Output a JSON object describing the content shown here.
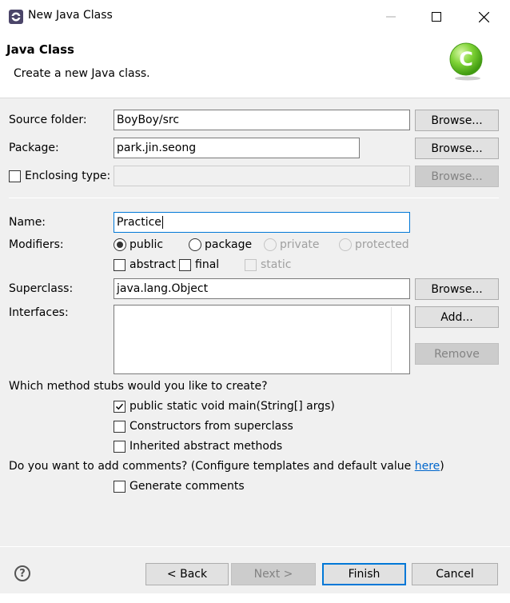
{
  "window": {
    "title": "New Java Class"
  },
  "header": {
    "title": "Java Class",
    "subtitle": "Create a new Java class."
  },
  "source_folder": {
    "label": "Source folder:",
    "value": "BoyBoy/src",
    "browse": "Browse..."
  },
  "package": {
    "label": "Package:",
    "value": "park.jin.seong",
    "browse": "Browse..."
  },
  "enclosing": {
    "label": "Enclosing type:",
    "value": "",
    "checked": false,
    "browse": "Browse..."
  },
  "name": {
    "label": "Name:",
    "value": "Practice"
  },
  "modifiers": {
    "label": "Modifiers:",
    "access": [
      {
        "label": "public",
        "selected": true,
        "enabled": true
      },
      {
        "label": "package",
        "selected": false,
        "enabled": true
      },
      {
        "label": "private",
        "selected": false,
        "enabled": false
      },
      {
        "label": "protected",
        "selected": false,
        "enabled": false
      }
    ],
    "flags": [
      {
        "label": "abstract",
        "checked": false,
        "enabled": true
      },
      {
        "label": "final",
        "checked": false,
        "enabled": true
      },
      {
        "label": "static",
        "checked": false,
        "enabled": false
      }
    ]
  },
  "superclass": {
    "label": "Superclass:",
    "value": "java.lang.Object",
    "browse": "Browse..."
  },
  "interfaces": {
    "label": "Interfaces:",
    "add": "Add...",
    "remove": "Remove"
  },
  "stubs": {
    "question": "Which method stubs would you like to create?",
    "options": [
      {
        "label": "public static void main(String[] args)",
        "checked": true
      },
      {
        "label": "Constructors from superclass",
        "checked": false
      },
      {
        "label": "Inherited abstract methods",
        "checked": false
      }
    ]
  },
  "comments": {
    "question_prefix": "Do you want to add comments? (Configure templates and default value ",
    "link": "here",
    "question_suffix": ")",
    "option": "Generate comments",
    "checked": false
  },
  "buttons": {
    "back": "< Back",
    "next": "Next >",
    "finish": "Finish",
    "cancel": "Cancel"
  },
  "help_glyph": "?",
  "colors": {
    "accent": "#0078d7",
    "link": "#0066cc",
    "class_icon": "#5cbf1e"
  }
}
